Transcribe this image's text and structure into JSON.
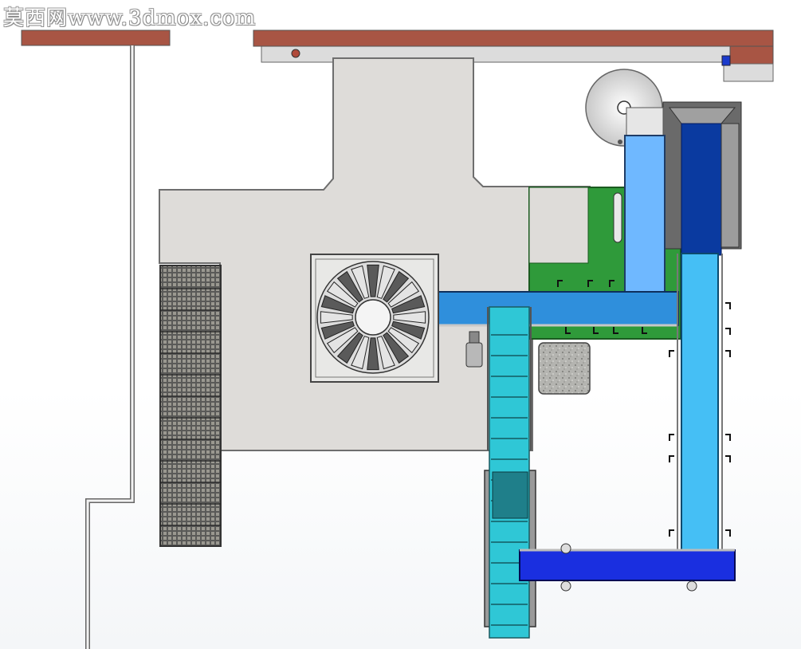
{
  "watermark": "莫西网www.3dmox.com",
  "colors": {
    "wall": "#a85544",
    "floor_plate": "#dddbd8",
    "machine_green": "#2f9a3a",
    "conveyor_blue": "#2f8fdc",
    "conveyor_light": "#6fb8ff",
    "conveyor_sky": "#45bff5",
    "conveyor_navy": "#0a3aa0",
    "conveyor_royal": "#1a2fe0",
    "bucket_cyan": "#2fc7d6",
    "granite": "#b8b8b4"
  },
  "components": [
    "left-wall-beam",
    "top-wall-beam",
    "floor-plate",
    "combination-weigher",
    "incline-bucket-conveyor",
    "vertical-bucket-elevator",
    "film-roll",
    "packing-machine",
    "output-conveyor",
    "return-conveyor",
    "mesh-platform",
    "granite-block"
  ]
}
